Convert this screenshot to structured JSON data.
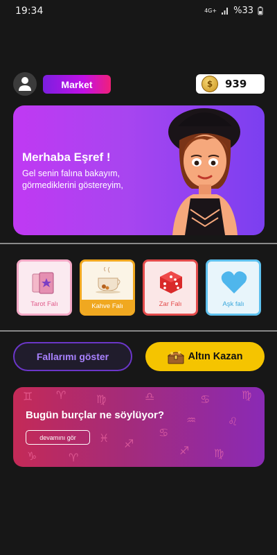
{
  "status_bar": {
    "time": "19:34",
    "network": "4G+",
    "battery": "%33"
  },
  "header": {
    "market_label": "Market",
    "coin_count": "939"
  },
  "hero": {
    "title": "Merhaba Eşref !",
    "line1": "Gel senin falına bakayım,",
    "line2": "görmediklerini göstereyim,"
  },
  "fortunes": [
    {
      "label": "Tarot Falı"
    },
    {
      "label": "Kahve Falı"
    },
    {
      "label": "Zar Falı"
    },
    {
      "label": "Aşk falı"
    }
  ],
  "buttons": {
    "my_fortunes": "Fallarımı göster",
    "earn_gold": "Altın Kazan"
  },
  "horoscope": {
    "title": "Bugün burçlar ne söylüyor?",
    "more": "devamını gör"
  },
  "colors": {
    "background": "#171717",
    "accent_purple": "#a845f0",
    "gold": "#f5c400",
    "horoscope": "#a42b7a"
  }
}
